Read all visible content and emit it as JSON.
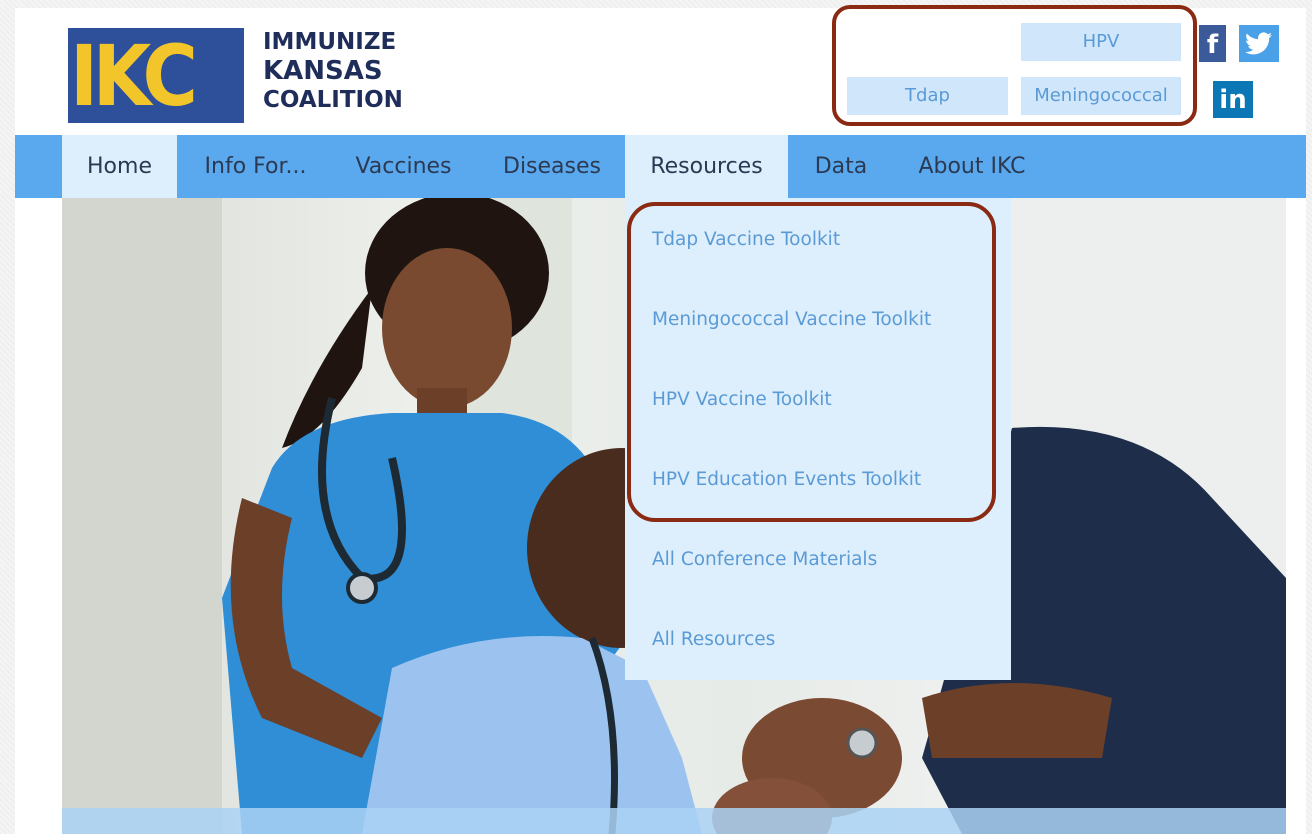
{
  "logo": {
    "mark": "IKC",
    "line1": "IMMUNIZE",
    "line2": "KANSAS",
    "line3": "COALITION"
  },
  "quick_links": {
    "hpv": "HPV",
    "tdap": "Tdap",
    "meningococcal": "Meningococcal"
  },
  "social": {
    "facebook": "f",
    "twitter": "☆",
    "linkedin": "in"
  },
  "nav": {
    "items": [
      "Home",
      "Info For...",
      "Vaccines",
      "Diseases",
      "Resources",
      "Data",
      "About IKC"
    ]
  },
  "resources_dropdown": {
    "items": [
      "Tdap Vaccine Toolkit",
      "Meningococcal Vaccine Toolkit",
      "HPV Vaccine Toolkit",
      "HPV Education Events Toolkit",
      "All Conference Materials",
      "All Resources"
    ]
  },
  "colors": {
    "nav_bar": "#5aa8ee",
    "nav_active": "#ddeefc",
    "link_blue": "#5b9bd5",
    "logo_blue": "#2e4f9a",
    "logo_yellow": "#f2c62a",
    "highlight": "#8b2a13"
  }
}
